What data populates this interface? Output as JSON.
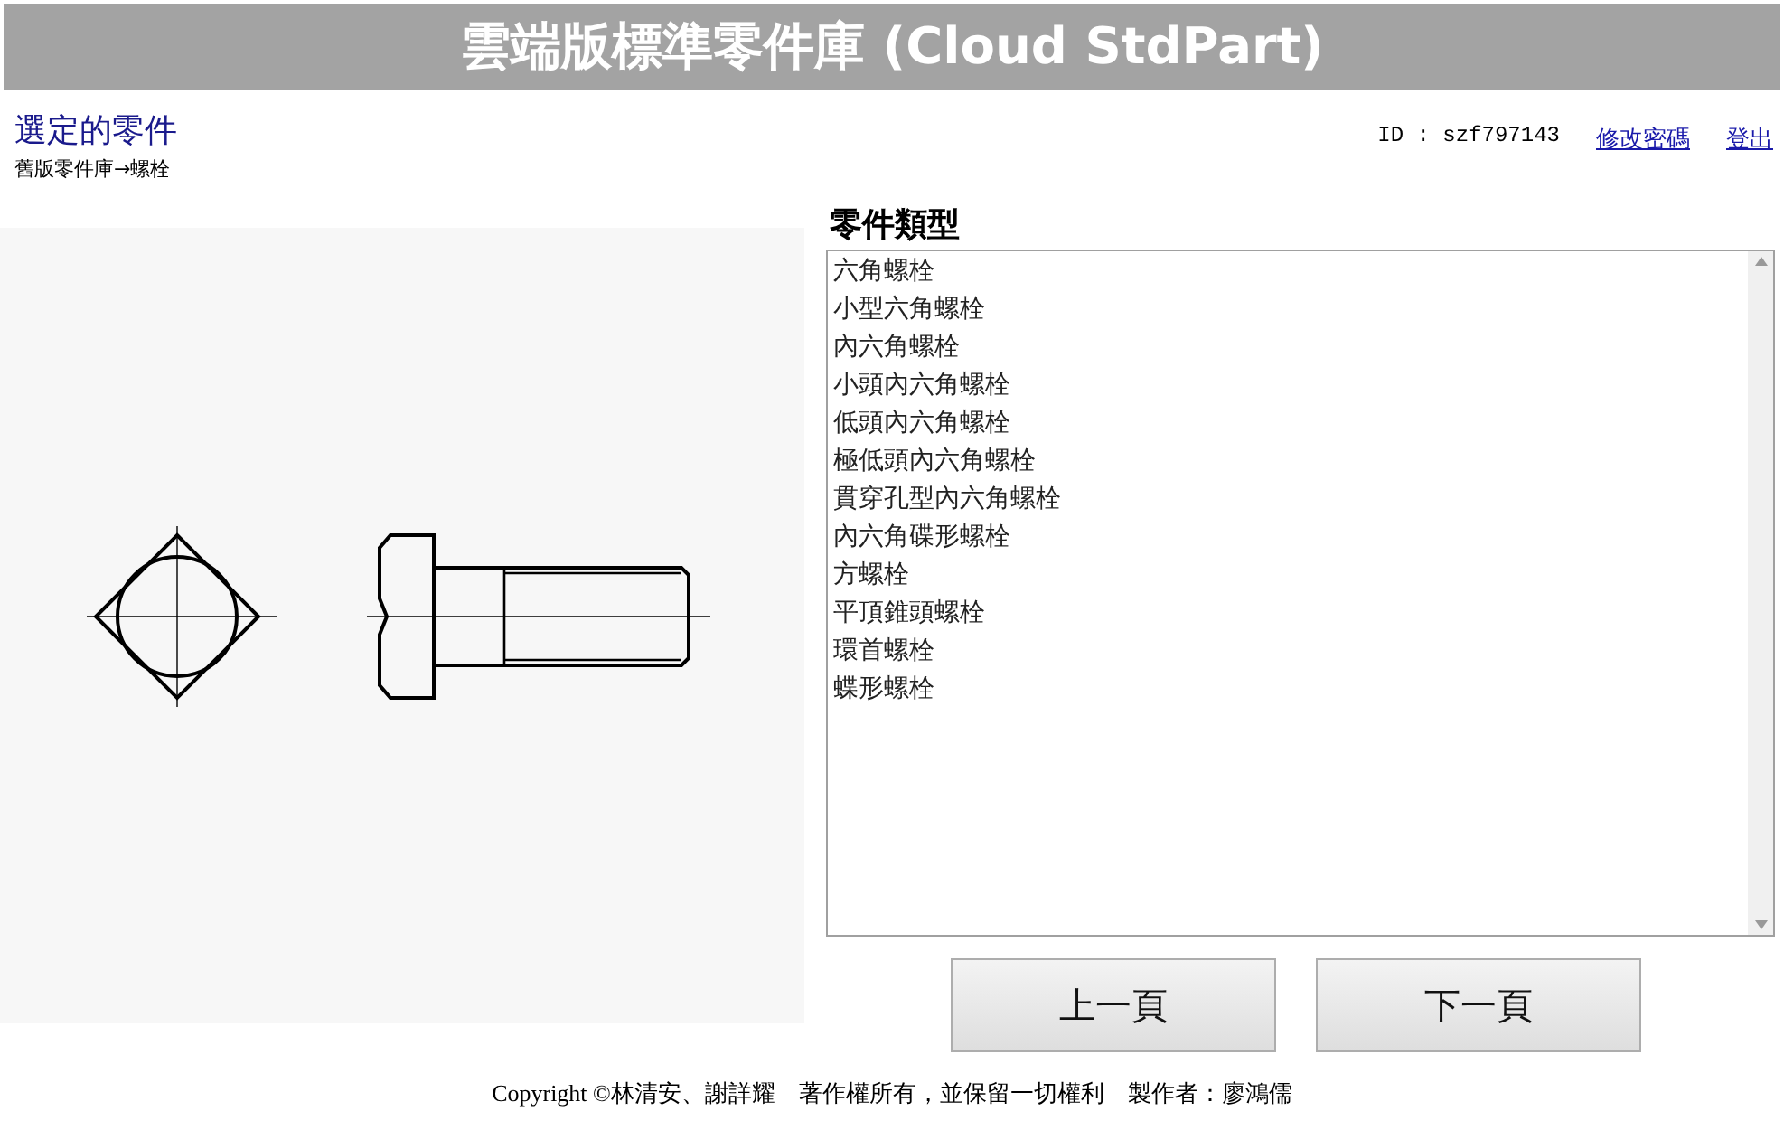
{
  "header": {
    "title": "雲端版標準零件庫 (Cloud StdPart)"
  },
  "selection": {
    "title": "選定的零件",
    "path": "舊版零件庫→螺栓"
  },
  "account": {
    "id": "ID : szf797143",
    "links": [
      "修改密碼",
      "登出"
    ]
  },
  "part_types": {
    "title": "零件類型",
    "items": [
      {
        "label": "六角螺栓",
        "selected": false
      },
      {
        "label": "小型六角螺栓",
        "selected": false
      },
      {
        "label": "內六角螺栓",
        "selected": false
      },
      {
        "label": "小頭內六角螺栓",
        "selected": false
      },
      {
        "label": "低頭內六角螺栓",
        "selected": false
      },
      {
        "label": "極低頭內六角螺栓",
        "selected": false
      },
      {
        "label": "貫穿孔型內六角螺栓",
        "selected": false
      },
      {
        "label": "內六角碟形螺栓",
        "selected": false
      },
      {
        "label": "方螺栓",
        "selected": false
      },
      {
        "label": "平頂錐頭螺栓",
        "selected": false
      },
      {
        "label": "環首螺栓",
        "selected": false
      },
      {
        "label": "蝶形螺栓",
        "selected": false
      }
    ]
  },
  "buttons": [
    "上一頁",
    "下一頁"
  ],
  "footer": "Copyright ©林清安、謝詳耀　著作權所有，並保留一切權利　製作者：廖鴻儒"
}
